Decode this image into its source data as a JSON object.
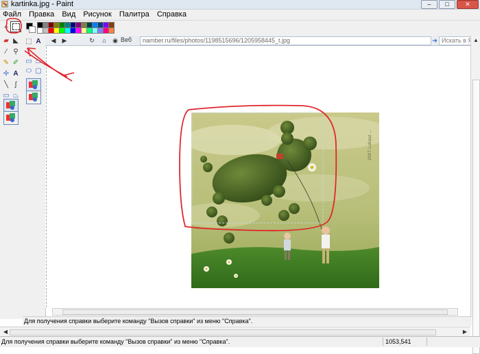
{
  "window": {
    "title": "kartinka.jpg - Paint"
  },
  "menu": {
    "items": [
      "Файл",
      "Правка",
      "Вид",
      "Рисунок",
      "Палитра",
      "Справка"
    ]
  },
  "palette": {
    "colors": [
      "#000000",
      "#808080",
      "#800000",
      "#808000",
      "#008000",
      "#008080",
      "#000080",
      "#800080",
      "#808040",
      "#004040",
      "#0080ff",
      "#004080",
      "#8000ff",
      "#804000",
      "#ffffff",
      "#c0c0c0",
      "#ff0000",
      "#ffff00",
      "#00ff00",
      "#00ffff",
      "#0000ff",
      "#ff00ff",
      "#ffff80",
      "#00ff80",
      "#80ffff",
      "#8080ff",
      "#ff0080",
      "#ff8040"
    ]
  },
  "browser": {
    "web_label": "Веб",
    "address": "namber.ru/files/photos/1198515696/1205958445_t.jpg",
    "search_placeholder": "Искать в Яндексе"
  },
  "photo": {
    "watermark": "2007 Lukasz ..."
  },
  "inner_status": {
    "text": "Для получения справки выберите команду \"Вызов справки\" из меню \"Справка\"."
  },
  "status": {
    "text": "Для получения справки выберите команду \"Вызов справки\" из меню \"Справка\".",
    "coords": "1053,541"
  },
  "annotation": {
    "color": "#e0262d"
  }
}
